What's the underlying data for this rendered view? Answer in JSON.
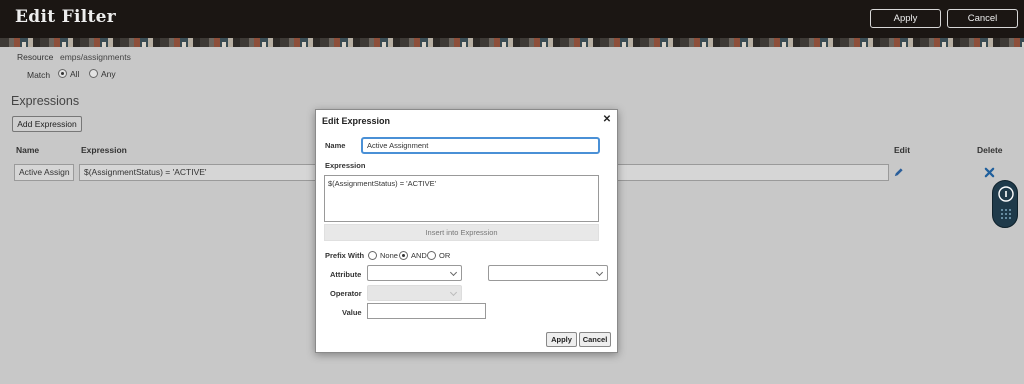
{
  "header": {
    "title": "Edit Filter",
    "apply_label": "Apply",
    "cancel_label": "Cancel"
  },
  "filter": {
    "resource_label": "Resource",
    "resource_value": "emps/assignments",
    "match_label": "Match",
    "match_options": [
      "All",
      "Any"
    ],
    "match_selected": "All"
  },
  "expressions": {
    "section_title": "Expressions",
    "add_button_label": "Add Expression",
    "columns": {
      "name": "Name",
      "expression": "Expression",
      "edit": "Edit",
      "delete": "Delete"
    },
    "rows": [
      {
        "name": "Active Assign",
        "expression": "$(AssignmentStatus) = 'ACTIVE'"
      }
    ]
  },
  "dialog": {
    "title": "Edit Expression",
    "name_label": "Name",
    "name_value": "Active Assignment",
    "expression_label": "Expression",
    "expression_value": "$(AssignmentStatus) = 'ACTIVE'",
    "insert_button_label": "Insert into Expression",
    "prefix_label": "Prefix With",
    "prefix_options": [
      "None",
      "AND",
      "OR"
    ],
    "prefix_selected": "AND",
    "attribute_label": "Attribute",
    "operator_label": "Operator",
    "value_label": "Value",
    "apply_label": "Apply",
    "cancel_label": "Cancel"
  },
  "colors": {
    "header_bg": "#1b1613",
    "focus_border": "#4a90d6",
    "edit_icon": "#2a5e9a",
    "delete_icon": "#1f5f9c"
  }
}
